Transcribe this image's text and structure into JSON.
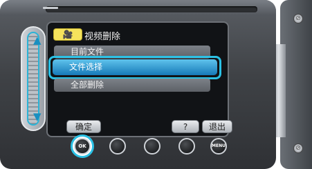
{
  "screen": {
    "mode_icon": "video-camera-icon",
    "title": "视频删除",
    "menu_items": [
      {
        "label": "目前文件",
        "selected": false
      },
      {
        "label": "文件选择",
        "selected": true
      },
      {
        "label": "全部删除",
        "selected": false
      }
    ]
  },
  "softkeys": {
    "ok_label": "确定",
    "help_label": "?",
    "exit_label": "退出"
  },
  "hardware_buttons": {
    "ok_label": "OK",
    "menu_label": "MENU"
  },
  "colors": {
    "highlight": "#2bc1e5",
    "selected_row": "#1679b8",
    "mode_icon_bg": "#f5e35c"
  }
}
